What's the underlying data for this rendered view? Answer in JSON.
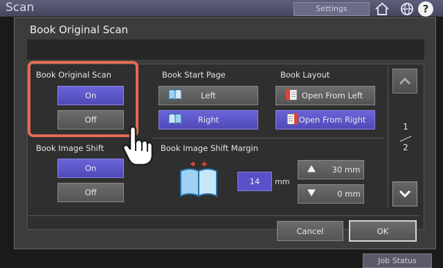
{
  "app": {
    "title": "Scan",
    "settings_label": "Settings",
    "job_status_label": "Job Status",
    "help_label": "?"
  },
  "dialog": {
    "title": "Book Original Scan",
    "book_original_scan": {
      "label": "Book Original Scan",
      "on": "On",
      "off": "Off",
      "selected": "On"
    },
    "book_start_page": {
      "label": "Book Start Page",
      "left": "Left",
      "right": "Right",
      "selected": "Right"
    },
    "book_layout": {
      "label": "Book Layout",
      "open_from_left": "Open From Left",
      "open_from_right": "Open From Right",
      "selected": "Open From Right"
    },
    "book_image_shift": {
      "label": "Book Image Shift",
      "on": "On",
      "off": "Off",
      "selected": "On"
    },
    "book_image_shift_margin": {
      "label": "Book Image Shift Margin",
      "value": "14",
      "unit": "mm",
      "max": "30 mm",
      "min": "0 mm"
    },
    "page": {
      "current": "1",
      "total": "2"
    },
    "cancel_label": "Cancel",
    "ok_label": "OK"
  },
  "colors": {
    "accent": "#5a53c9",
    "highlight": "#e46b55",
    "button": "#5e5e5e",
    "dialog": "#3c3c3c"
  }
}
